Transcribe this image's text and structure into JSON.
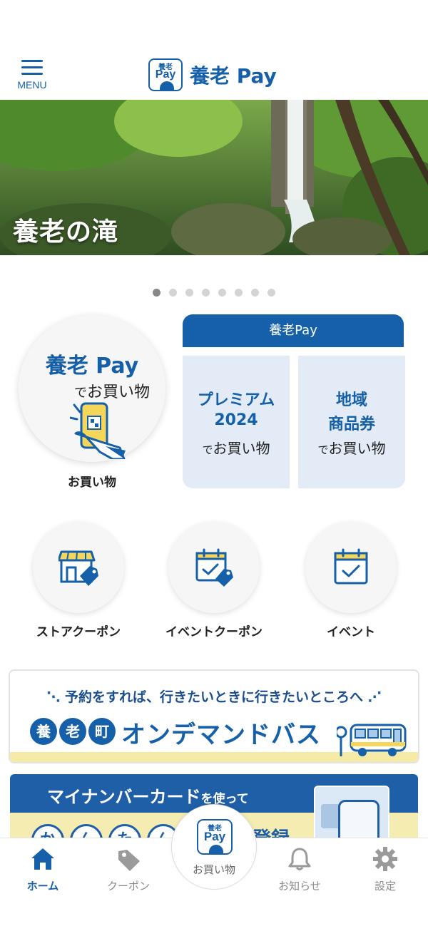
{
  "header": {
    "menu_label": "MENU",
    "logo_badge_kanji": "養老",
    "logo_badge_pay": "Pay",
    "logo_text": "養老 Pay"
  },
  "banner": {
    "title": "養老の滝",
    "slide_count": 8,
    "active_slide": 1
  },
  "shopping": {
    "title": "養老 Pay",
    "subtitle_de": "で",
    "subtitle_main": "お買い物",
    "label": "お買い物"
  },
  "pay_card": {
    "header": "養老Pay",
    "tiles": [
      {
        "line1": "プレミアム",
        "line2": "2024",
        "de": "で",
        "line3": "お買い物"
      },
      {
        "line1": "地域",
        "line2": "商品券",
        "de": "で",
        "line3": "お買い物"
      }
    ]
  },
  "features": [
    {
      "label": "ストアクーポン",
      "icon": "store-coupon-icon"
    },
    {
      "label": "イベントクーポン",
      "icon": "event-coupon-icon"
    },
    {
      "label": "イベント",
      "icon": "calendar-check-icon"
    }
  ],
  "bus_banner": {
    "subtitle": "予約をすれば、行きたいときに行きたいところへ",
    "town_chars": [
      "養",
      "老",
      "町"
    ],
    "main": "オンデマンドバス"
  },
  "mynumber_banner": {
    "title_main": "マイナンバーカード",
    "title_suffix": "を使って",
    "circles": [
      "か",
      "ん",
      "た",
      "ん"
    ],
    "right_text": "登録"
  },
  "bottom_nav": {
    "home": "ホーム",
    "coupon": "クーポン",
    "center": "お買い物",
    "center_badge_kanji": "養老",
    "center_badge_pay": "Pay",
    "notice": "お知らせ",
    "settings": "設定"
  },
  "colors": {
    "brand_blue": "#1560a8",
    "tile_bg": "#e3ecf6",
    "yellow_strip": "#f5eaa6",
    "inactive_gray": "#8a8a8a"
  }
}
